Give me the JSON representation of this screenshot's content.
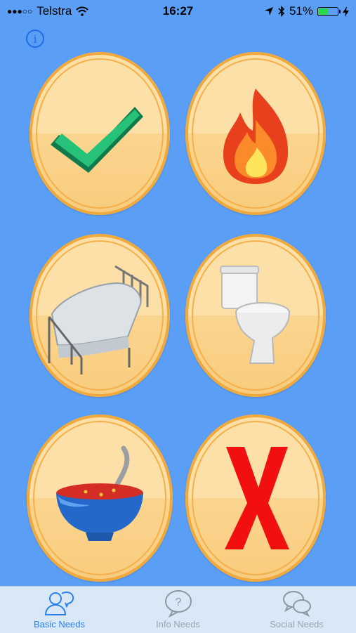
{
  "status": {
    "carrier": "Telstra",
    "signal": "●●●○○",
    "time": "16:27",
    "battery": "51%",
    "battery_level": 0.51
  },
  "info_button": {
    "label": "i",
    "icon": "info-icon"
  },
  "grid": [
    {
      "name": "yes",
      "icon": "checkmark-icon"
    },
    {
      "name": "fire",
      "icon": "fire-icon"
    },
    {
      "name": "bed",
      "icon": "bed-icon"
    },
    {
      "name": "toilet",
      "icon": "toilet-icon"
    },
    {
      "name": "food",
      "icon": "soup-bowl-icon"
    },
    {
      "name": "no",
      "icon": "cross-icon"
    }
  ],
  "tabs": [
    {
      "label": "Basic Needs",
      "icon": "people-chat-icon",
      "active": true
    },
    {
      "label": "Info Needs",
      "icon": "question-bubble-icon",
      "active": false
    },
    {
      "label": "Social Needs",
      "icon": "chat-bubbles-icon",
      "active": false
    }
  ],
  "colors": {
    "background": "#5b9ef5",
    "accent": "#2a80ee",
    "coin": "#fde0a8",
    "coin_border": "#f0a93c"
  }
}
